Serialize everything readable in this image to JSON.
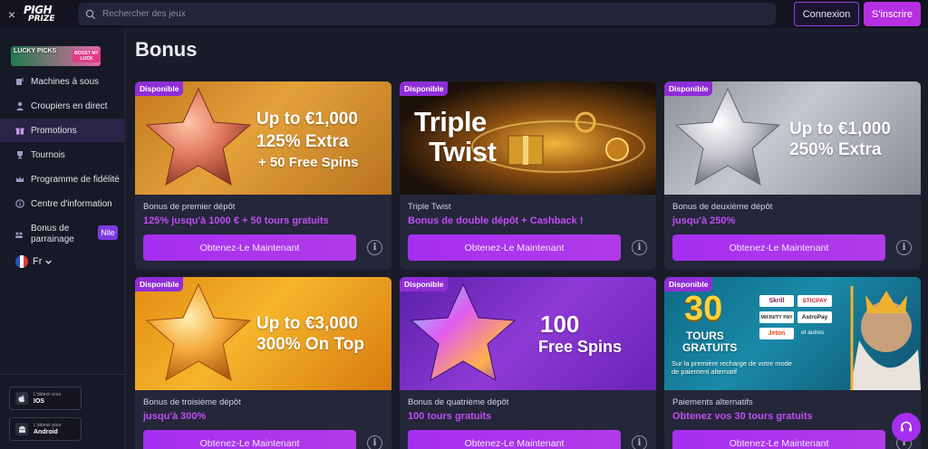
{
  "header": {
    "close_label": "×",
    "logo_line1": "PIGH",
    "logo_line2": "PRIZE",
    "search_placeholder": "Rechercher des jeux",
    "login_label": "Connexion",
    "signup_label": "S'inscrire"
  },
  "sidebar": {
    "promo_banner": {
      "title": "LUCKY PICKS",
      "cta": "BOOST MY LUCK"
    },
    "items": [
      {
        "label": "Machines à sous",
        "icon": "slot-machine-icon"
      },
      {
        "label": "Croupiers en direct",
        "icon": "dealer-icon"
      },
      {
        "label": "Promotions",
        "icon": "gift-icon",
        "active": true
      },
      {
        "label": "Tournois",
        "icon": "trophy-icon"
      },
      {
        "label": "Programme de fidélité",
        "icon": "crown-icon"
      },
      {
        "label": "Centre d'information",
        "icon": "info-icon"
      }
    ],
    "referral": {
      "line1": "Bonus de",
      "line2": "parrainage",
      "badge": "Nile"
    },
    "language": "Fr",
    "apps": [
      {
        "top": "L'obtenir pour",
        "name": "IOS",
        "icon": "apple-icon"
      },
      {
        "top": "L'obtenir pour",
        "name": "Android",
        "icon": "android-icon"
      }
    ]
  },
  "main": {
    "title": "Bonus",
    "badge_label": "Disponible",
    "cta_label": "Obtenez-Le Maintenant",
    "cards": [
      {
        "subtitle": "Bonus de premier dépôt",
        "offer": "125% jusqu'à 1000 € + 50 tours gratuits",
        "img_lines": [
          "Up to €1,000",
          "125% Extra",
          "+ 50 Free Spins"
        ]
      },
      {
        "subtitle": "Triple Twist",
        "offer": "Bonus de double dépôt + Cashback !",
        "img_lines": [
          "Triple",
          "Twist"
        ]
      },
      {
        "subtitle": "Bonus de deuxième dépôt",
        "offer": "jusqu'à 250%",
        "img_lines": [
          "Up to €1,000",
          "250% Extra"
        ]
      },
      {
        "subtitle": "Bonus de troisième dépôt",
        "offer": "jusqu'à 300%",
        "img_lines": [
          "Up to €3,000",
          "300% On Top"
        ]
      },
      {
        "subtitle": "Bonus de quatrième dépôt",
        "offer": "100 tours gratuits",
        "img_lines": [
          "100",
          "Free Spins"
        ]
      },
      {
        "subtitle": "Paiements alternatifs",
        "offer": "Obtenez vos 30 tours gratuits",
        "img_lines": [
          "30",
          "TOURS",
          "GRATUITS",
          "Sur la première recharge de votre mode",
          "de paiement alternatif"
        ],
        "providers": [
          "Skrill",
          "STICPAY",
          "MiFINITY PAY",
          "AstroPay",
          "Jeton",
          "et autres"
        ]
      }
    ]
  },
  "colors": {
    "accent": "#a52ff0",
    "offer_text": "#c14ef3",
    "badge": "#8f2ed6"
  }
}
